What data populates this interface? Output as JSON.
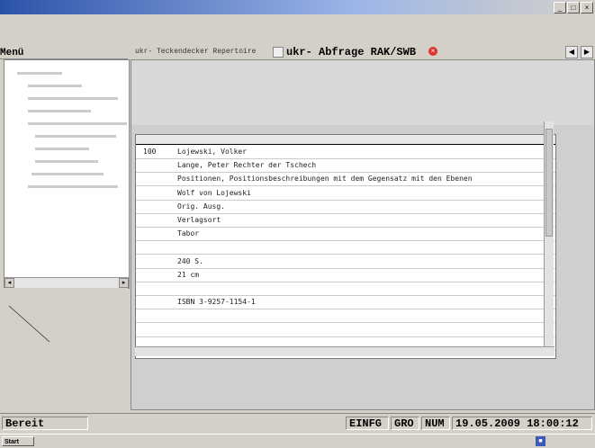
{
  "window": {
    "subtitle": "",
    "menu": [
      "",
      "",
      "",
      "",
      "",
      ""
    ]
  },
  "nav": {
    "label": "Menü"
  },
  "tabs": {
    "first": "ukr- Teckendecker Repertoire",
    "active": "ukr- Abfrage RAK/SWB"
  },
  "query": {
    "label": "",
    "title": "",
    "datetime": ""
  },
  "results": {
    "header": "",
    "rows": [
      {
        "code": "100",
        "text": "Lojewski, Volker"
      },
      {
        "code": "",
        "text": "Lange, Peter Rechter der Tschech"
      },
      {
        "code": "",
        "text": "Positionen, Positionsbeschreibungen mit dem Gegensatz mit den Ebenen"
      },
      {
        "code": "",
        "text": "Wolf von Lojewski"
      },
      {
        "code": "",
        "text": "Orig. Ausg."
      },
      {
        "code": "",
        "text": "Verlagsort"
      },
      {
        "code": "",
        "text": "Tabor"
      },
      {
        "code": "",
        "text": ""
      },
      {
        "code": "",
        "text": "240 S."
      },
      {
        "code": "",
        "text": "21 cm"
      },
      {
        "code": "",
        "text": ""
      },
      {
        "code": "",
        "text": "ISBN 3-9257-1154-1"
      },
      {
        "code": "",
        "text": ""
      },
      {
        "code": "",
        "text": ""
      },
      {
        "code": "",
        "text": ""
      },
      {
        "code": "",
        "text": ""
      }
    ]
  },
  "status": {
    "ready": "Bereit",
    "flags": [
      "EINFG",
      "GRO",
      "NUM"
    ],
    "datetime": "19.05.2009 18:00:12"
  },
  "taskbar": {
    "start": "Start",
    "clock": ""
  }
}
